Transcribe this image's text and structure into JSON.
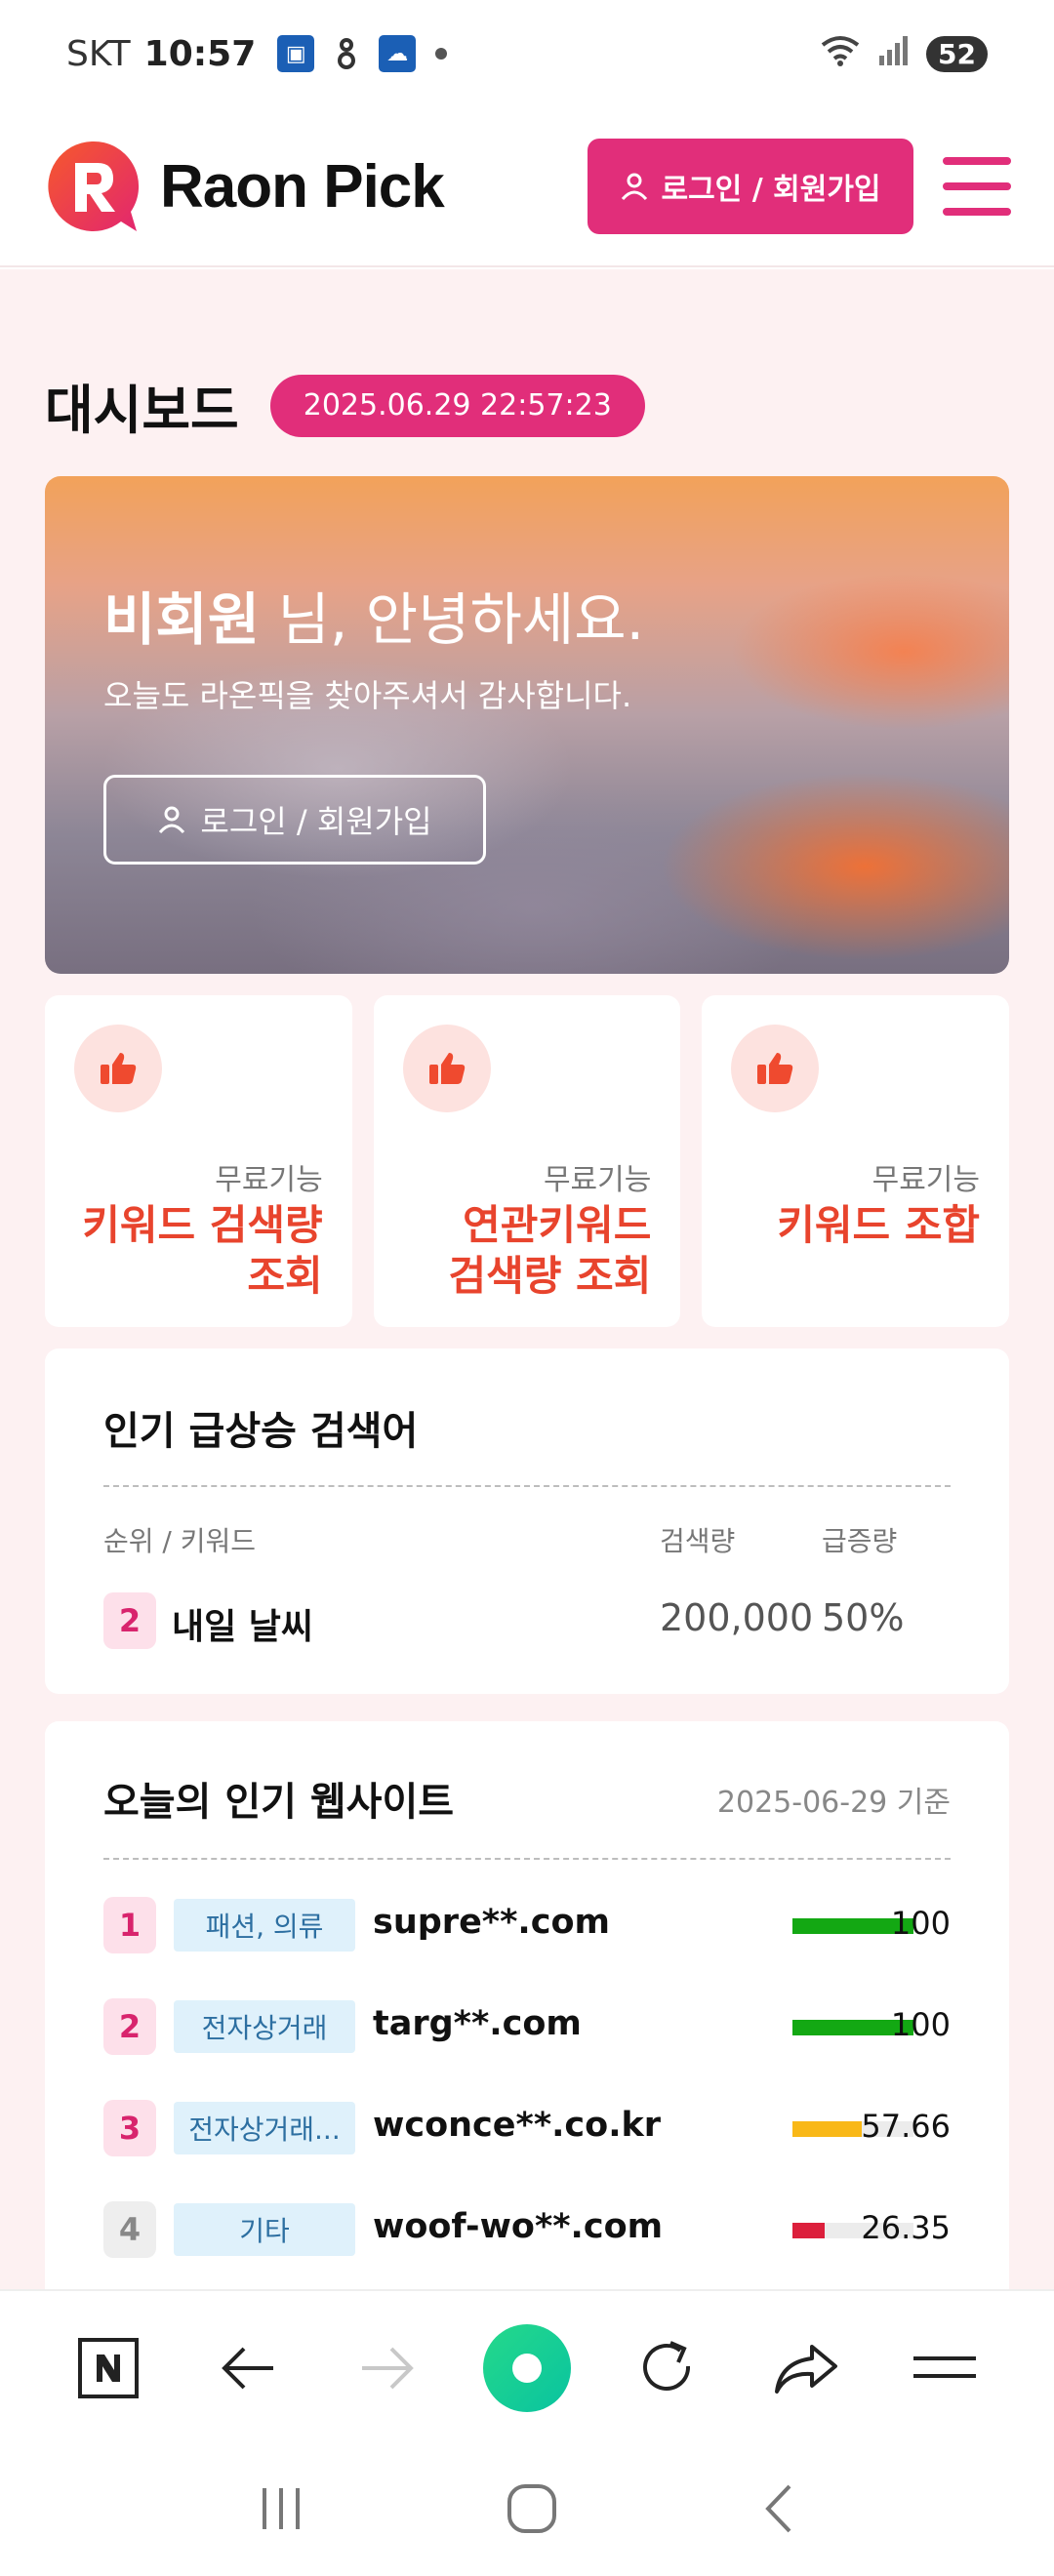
{
  "status_bar": {
    "carrier": "SKT",
    "time": "10:57",
    "battery": "52"
  },
  "header": {
    "brand": "Raon Pick",
    "login_label": "로그인 / 회원가입"
  },
  "dashboard": {
    "title": "대시보드",
    "datetime": "2025.06.29 22:57:23"
  },
  "hero": {
    "user": "비회원",
    "greeting_suffix": " 님, 안녕하세요.",
    "subtitle": "오늘도 라온픽을 찾아주셔서 감사합니다.",
    "login_label": "로그인 / 회원가입"
  },
  "features": [
    {
      "tag": "무료기능",
      "name_line1": "키워드 검색량",
      "name_line2": "조회",
      "icon": "thumbs-up-icon"
    },
    {
      "tag": "무료기능",
      "name_line1": "연관키워드",
      "name_line2": "검색량 조회",
      "icon": "thumbs-up-icon"
    },
    {
      "tag": "무료기능",
      "name_line1": "키워드 조합",
      "name_line2": "",
      "icon": "thumbs-up-icon"
    }
  ],
  "trending": {
    "title": "인기 급상승 검색어",
    "col_rank_keyword": "순위 / 키워드",
    "col_volume": "검색량",
    "col_growth": "급증량",
    "rows": [
      {
        "rank": "2",
        "keyword": "내일 날씨",
        "volume": "200,000",
        "growth": "50%"
      }
    ]
  },
  "websites": {
    "title": "오늘의 인기 웹사이트",
    "date_note": "2025-06-29 기준",
    "rows": [
      {
        "rank": "1",
        "category": "패션, 의류",
        "domain": "supre**.com",
        "score": "100",
        "fill": 1.0,
        "color": "#13a813"
      },
      {
        "rank": "2",
        "category": "전자상거래",
        "domain": "targ**.com",
        "score": "100",
        "fill": 1.0,
        "color": "#13a813"
      },
      {
        "rank": "3",
        "category": "전자상거래...",
        "domain": "wconce**.co.kr",
        "score": "57.66",
        "fill": 0.5766,
        "color": "#f9b817"
      },
      {
        "rank": "4",
        "category": "기타",
        "domain": "woof-wo**.com",
        "score": "26.35",
        "fill": 0.2635,
        "color": "#dc1f3c"
      }
    ]
  },
  "colors": {
    "accent": "#e12e7a",
    "feature_text": "#e8442d"
  }
}
